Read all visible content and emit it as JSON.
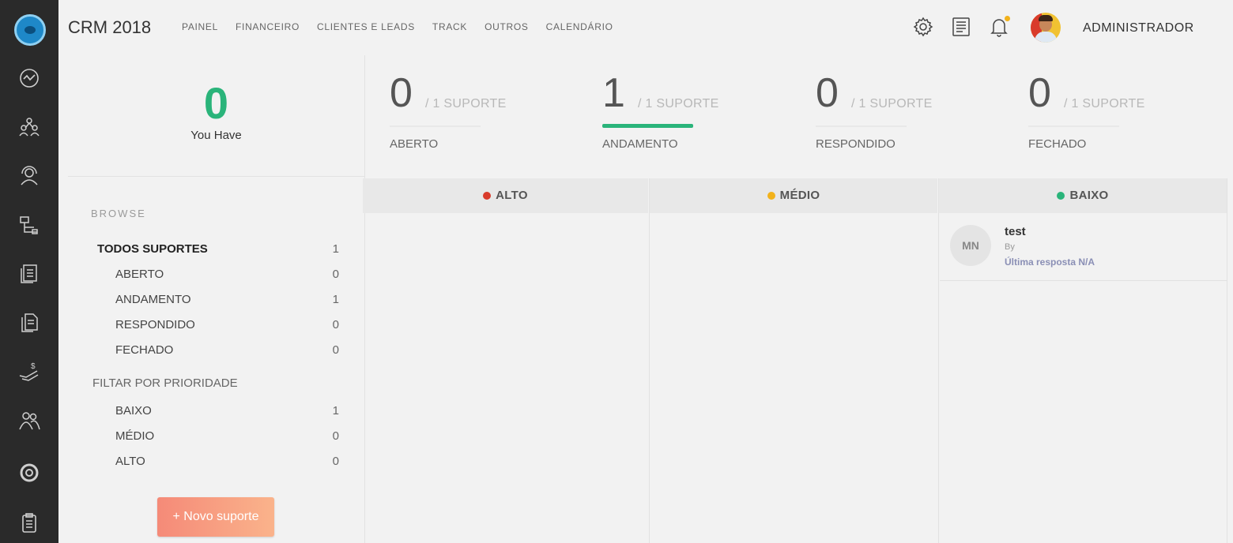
{
  "brand": "CRM 2018",
  "nav": [
    "PAINEL",
    "FINANCEIRO",
    "CLIENTES E LEADS",
    "TRACK",
    "OUTROS",
    "CALENDÁRIO"
  ],
  "user": {
    "name": "ADMINISTRADOR"
  },
  "summary": {
    "count": "0",
    "label": "You Have"
  },
  "stats": [
    {
      "value": "0",
      "of": "/ 1 SUPORTE",
      "label": "ABERTO",
      "active": false
    },
    {
      "value": "1",
      "of": "/ 1 SUPORTE",
      "label": "ANDAMENTO",
      "active": true
    },
    {
      "value": "0",
      "of": "/ 1 SUPORTE",
      "label": "RESPONDIDO",
      "active": false
    },
    {
      "value": "0",
      "of": "/ 1 SUPORTE",
      "label": "FECHADO",
      "active": false
    }
  ],
  "browse": {
    "title": "BROWSE",
    "all": {
      "label": "TODOS SUPORTES",
      "count": "1"
    },
    "status": [
      {
        "label": "ABERTO",
        "count": "0"
      },
      {
        "label": "ANDAMENTO",
        "count": "1"
      },
      {
        "label": "RESPONDIDO",
        "count": "0"
      },
      {
        "label": "FECHADO",
        "count": "0"
      }
    ],
    "priority_title": "FILTAR POR PRIORIDADE",
    "priority": [
      {
        "label": "BAIXO",
        "count": "1"
      },
      {
        "label": "MÉDIO",
        "count": "0"
      },
      {
        "label": "ALTO",
        "count": "0"
      }
    ]
  },
  "new_button": "+ Novo suporte",
  "columns": [
    {
      "label": "ALTO",
      "color": "#d93b2b"
    },
    {
      "label": "MÉDIO",
      "color": "#f2b21b"
    },
    {
      "label": "BAIXO",
      "color": "#2ab47a"
    }
  ],
  "ticket": {
    "initials": "MN",
    "title": "test",
    "by": "By",
    "last_reply": "Última resposta N/A"
  },
  "colors": {
    "accent": "#2ab47a",
    "button": "#f58a78",
    "rail": "#2a2a2a"
  }
}
